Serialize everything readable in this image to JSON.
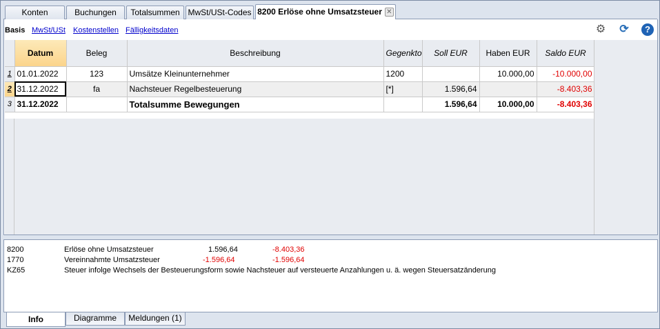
{
  "tabs": [
    {
      "label": "Konten"
    },
    {
      "label": "Buchungen"
    },
    {
      "label": "Totalsummen"
    },
    {
      "label": "MwSt/USt-Codes"
    },
    {
      "label": "8200 Erlöse ohne Umsatzsteuer"
    }
  ],
  "subtabs": [
    "Basis",
    "MwSt/USt",
    "Kostenstellen",
    "Fälligkeitsdaten"
  ],
  "toolbar": {
    "settings_icon": "gear-icon",
    "refresh_icon": "refresh-icon",
    "help_icon": "help-icon",
    "help_glyph": "?"
  },
  "columns": [
    "Datum",
    "Beleg",
    "Beschreibung",
    "Gegenkto.",
    "Soll EUR",
    "Haben EUR",
    "Saldo EUR"
  ],
  "rows": [
    {
      "num": "1",
      "datum": "01.01.2022",
      "beleg": "123",
      "beschreibung": "Umsätze Kleinunternehmer",
      "gegenkto": "1200",
      "soll": "",
      "haben": "10.000,00",
      "saldo": "-10.000,00"
    },
    {
      "num": "2",
      "datum": "31.12.2022",
      "beleg": "fa",
      "beschreibung": "Nachsteuer Regelbesteuerung",
      "gegenkto": "[*]",
      "soll": "1.596,64",
      "haben": "",
      "saldo": "-8.403,36"
    },
    {
      "num": "3",
      "datum": "31.12.2022",
      "beleg": "",
      "beschreibung": "Totalsumme Bewegungen",
      "gegenkto": "",
      "soll": "1.596,64",
      "haben": "10.000,00",
      "saldo": "-8.403,36"
    }
  ],
  "info": [
    {
      "code": "8200",
      "text": "Erlöse ohne Umsatzsteuer",
      "v1": "1.596,64",
      "v2": "-8.403,36"
    },
    {
      "code": "1770",
      "text": "Vereinnahmte Umsatzsteuer",
      "v1": "-1.596,64",
      "v2": "-1.596,64"
    },
    {
      "code": "KZ65",
      "text": "Steuer infolge Wechsels der Besteuerungsform sowie Nachsteuer auf versteuerte Anzahlungen u. ä. wegen Steuersatzänderung",
      "v1": "",
      "v2": ""
    }
  ],
  "bottom_tabs": [
    "Info",
    "Diagramme",
    "Meldungen (1)"
  ],
  "colors": {
    "negative": "#e00000",
    "selected_header": "#fbd48b",
    "link": "#0000cc"
  }
}
